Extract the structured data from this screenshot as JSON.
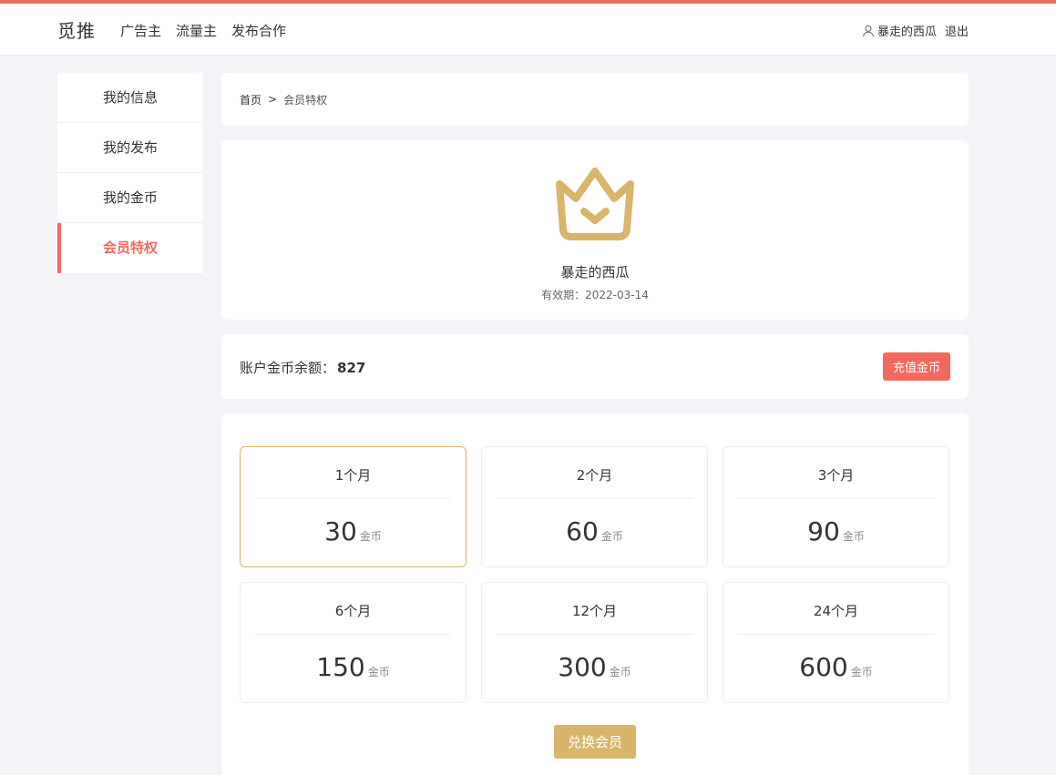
{
  "header": {
    "brand": "觅推",
    "nav": [
      "广告主",
      "流量主",
      "发布合作"
    ],
    "username": "暴走的西瓜",
    "logout": "退出"
  },
  "sidebar": {
    "items": [
      {
        "label": "我的信息",
        "active": false
      },
      {
        "label": "我的发布",
        "active": false
      },
      {
        "label": "我的金币",
        "active": false
      },
      {
        "label": "会员特权",
        "active": true
      }
    ]
  },
  "breadcrumb": {
    "home": "首页",
    "separator": ">",
    "current": "会员特权"
  },
  "profile": {
    "icon": "crown-icon",
    "username": "暴走的西瓜",
    "expiry_label": "有效期：",
    "expiry_date": "2022-03-14"
  },
  "balance": {
    "label": "账户金币余额：",
    "value": "827",
    "recharge_label": "充值金币"
  },
  "plans": [
    {
      "duration": "1个月",
      "price": "30",
      "unit": "金币",
      "selected": true
    },
    {
      "duration": "2个月",
      "price": "60",
      "unit": "金币",
      "selected": false
    },
    {
      "duration": "3个月",
      "price": "90",
      "unit": "金币",
      "selected": false
    },
    {
      "duration": "6个月",
      "price": "150",
      "unit": "金币",
      "selected": false
    },
    {
      "duration": "12个月",
      "price": "300",
      "unit": "金币",
      "selected": false
    },
    {
      "duration": "24个月",
      "price": "600",
      "unit": "金币",
      "selected": false
    }
  ],
  "exchange_label": "兑换会员",
  "colors": {
    "accent": "#f26a5e",
    "gold": "#d8b56a",
    "background": "#f3f3f8"
  }
}
